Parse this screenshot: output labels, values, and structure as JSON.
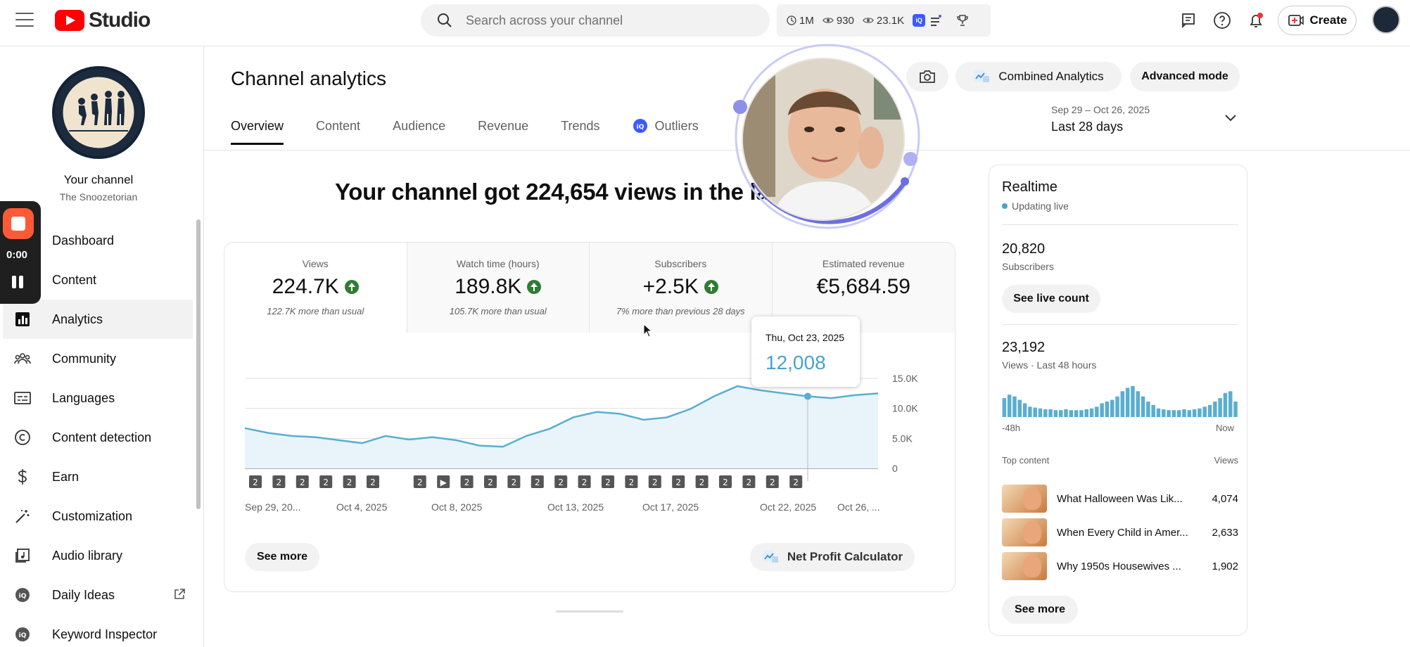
{
  "header": {
    "logo_text": "Studio",
    "search_placeholder": "Search across your channel",
    "stats": {
      "a": "1M",
      "b": "930",
      "c": "23.1K"
    },
    "create_label": "Create"
  },
  "sidebar": {
    "channel_name": "Your channel",
    "channel_handle": "The Snoozetorian",
    "items": [
      {
        "label": "Dashboard",
        "icon": "dashboard-icon"
      },
      {
        "label": "Content",
        "icon": "content-icon"
      },
      {
        "label": "Analytics",
        "icon": "analytics-icon"
      },
      {
        "label": "Community",
        "icon": "community-icon"
      },
      {
        "label": "Languages",
        "icon": "languages-icon"
      },
      {
        "label": "Content detection",
        "icon": "copyright-icon"
      },
      {
        "label": "Earn",
        "icon": "dollar-icon"
      },
      {
        "label": "Customization",
        "icon": "magic-wand-icon"
      },
      {
        "label": "Audio library",
        "icon": "music-icon"
      },
      {
        "label": "Daily Ideas",
        "icon": "vidiq-icon"
      },
      {
        "label": "Keyword Inspector",
        "icon": "vidiq-icon"
      }
    ],
    "recorder_time": "0:00"
  },
  "main": {
    "title": "Channel analytics",
    "tabs": [
      "Overview",
      "Content",
      "Audience",
      "Revenue",
      "Trends",
      "Outliers"
    ],
    "combined_label": "Combined Analytics",
    "advanced_label": "Advanced mode",
    "date_sub": "Sep 29 – Oct 26, 2025",
    "date_main": "Last 28 days",
    "headline": "Your channel got 224,654 views in the last",
    "metrics": [
      {
        "label": "Views",
        "value": "224.7K",
        "note": "122.7K more than usual",
        "up": true
      },
      {
        "label": "Watch time (hours)",
        "value": "189.8K",
        "note": "105.7K more than usual",
        "up": true
      },
      {
        "label": "Subscribers",
        "value": "+2.5K",
        "note": "7% more than previous 28 days",
        "up": true
      },
      {
        "label": "Estimated revenue",
        "value": "€5,684.59",
        "note": "",
        "up": false
      }
    ],
    "tooltip": {
      "date": "Thu, Oct 23, 2025",
      "value": "12,008"
    },
    "see_more": "See more",
    "npc_label": "Net Profit Calculator"
  },
  "chart_data": {
    "type": "area",
    "x_tick_labels": [
      "Sep 29, 20...",
      "Oct 4, 2025",
      "Oct 8, 2025",
      "Oct 13, 2025",
      "Oct 17, 2025",
      "Oct 22, 2025",
      "Oct 26, ..."
    ],
    "y_tick_labels": [
      "15.0K",
      "10.0K",
      "5.0K",
      "0"
    ],
    "ylim": [
      0,
      15000
    ],
    "values": [
      6700,
      5900,
      5400,
      5200,
      4700,
      4200,
      5400,
      4800,
      5200,
      4700,
      3800,
      3600,
      5400,
      6600,
      8500,
      9400,
      9100,
      8100,
      8500,
      9900,
      12000,
      13700,
      13000,
      12500,
      12008,
      11700,
      12200,
      12500
    ],
    "marker_labels": [
      "2",
      "2",
      "2",
      "2",
      "2",
      "2",
      "",
      "2",
      "▶",
      "2",
      "2",
      "2",
      "2",
      "2",
      "2",
      "2",
      "2",
      "2",
      "2",
      "2",
      "2",
      "2",
      "2",
      "2"
    ],
    "highlight_index": 24,
    "colors": {
      "line": "#5aaed0",
      "fill": "#e8f4f9"
    }
  },
  "realtime": {
    "title": "Realtime",
    "live": "Updating live",
    "subs_value": "20,820",
    "subs_label": "Subscribers",
    "live_btn": "See live count",
    "views_value": "23,192",
    "views_label": "Views · Last 48 hours",
    "axis_left": "-48h",
    "axis_right": "Now",
    "top_label": "Top content",
    "views_col": "Views",
    "bars": [
      22,
      26,
      24,
      20,
      16,
      12,
      11,
      10,
      9,
      9,
      8,
      8,
      9,
      8,
      8,
      8,
      9,
      10,
      12,
      16,
      18,
      20,
      24,
      30,
      34,
      36,
      30,
      24,
      18,
      14,
      10,
      9,
      8,
      8,
      8,
      9,
      8,
      9,
      10,
      12,
      14,
      18,
      22,
      28,
      30,
      18
    ],
    "top": [
      {
        "title": "What Halloween Was Lik...",
        "views": "4,074"
      },
      {
        "title": "When Every Child in Amer...",
        "views": "2,633"
      },
      {
        "title": "Why 1950s Housewives ...",
        "views": "1,902"
      }
    ],
    "see_more": "See more"
  }
}
